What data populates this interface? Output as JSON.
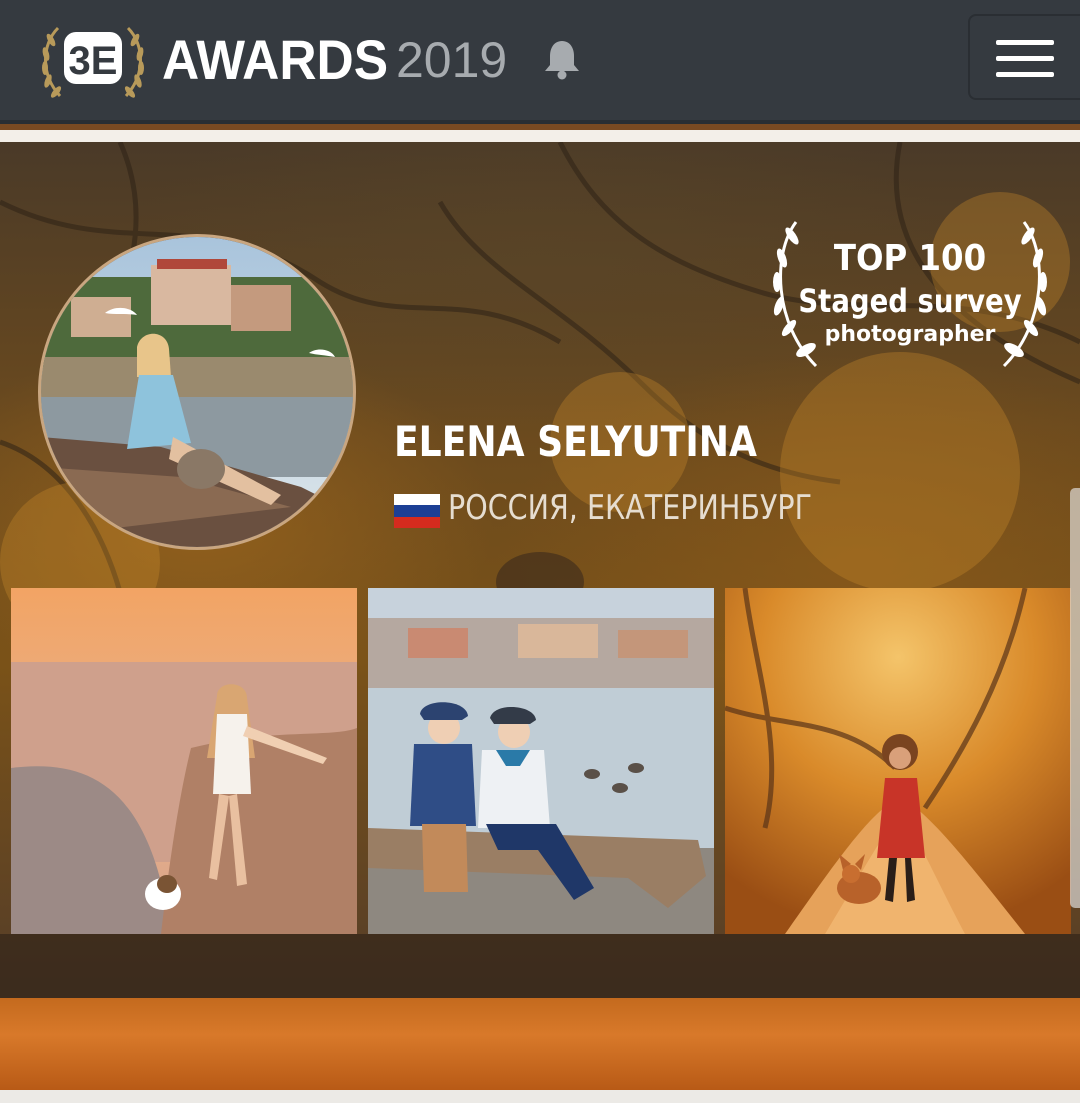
{
  "header": {
    "logo_label": "3E",
    "brand": "AWARDS",
    "year": "2019",
    "icons": {
      "logo": "laurel-logo-icon",
      "notifications": "bell-icon",
      "menu": "hamburger-menu-icon"
    },
    "colors": {
      "background": "#353a40",
      "year": "#a7abaf",
      "laurel": "#b89a5a"
    }
  },
  "profile": {
    "name": "ELENA SELYUTINA",
    "location": "РОССИЯ, ЕКАТЕРИНБУРГ",
    "flag": [
      "#ffffff",
      "#1c3f95",
      "#d52b1e"
    ]
  },
  "badge": {
    "line1": "TOP 100",
    "line2": "Staged survey",
    "line3": "photographer"
  },
  "gallery": [
    {
      "subject": "girl running on beach with dog"
    },
    {
      "subject": "two boys sitting on a log by the water"
    },
    {
      "subject": "girl with a fox on an autumn forest path"
    }
  ]
}
